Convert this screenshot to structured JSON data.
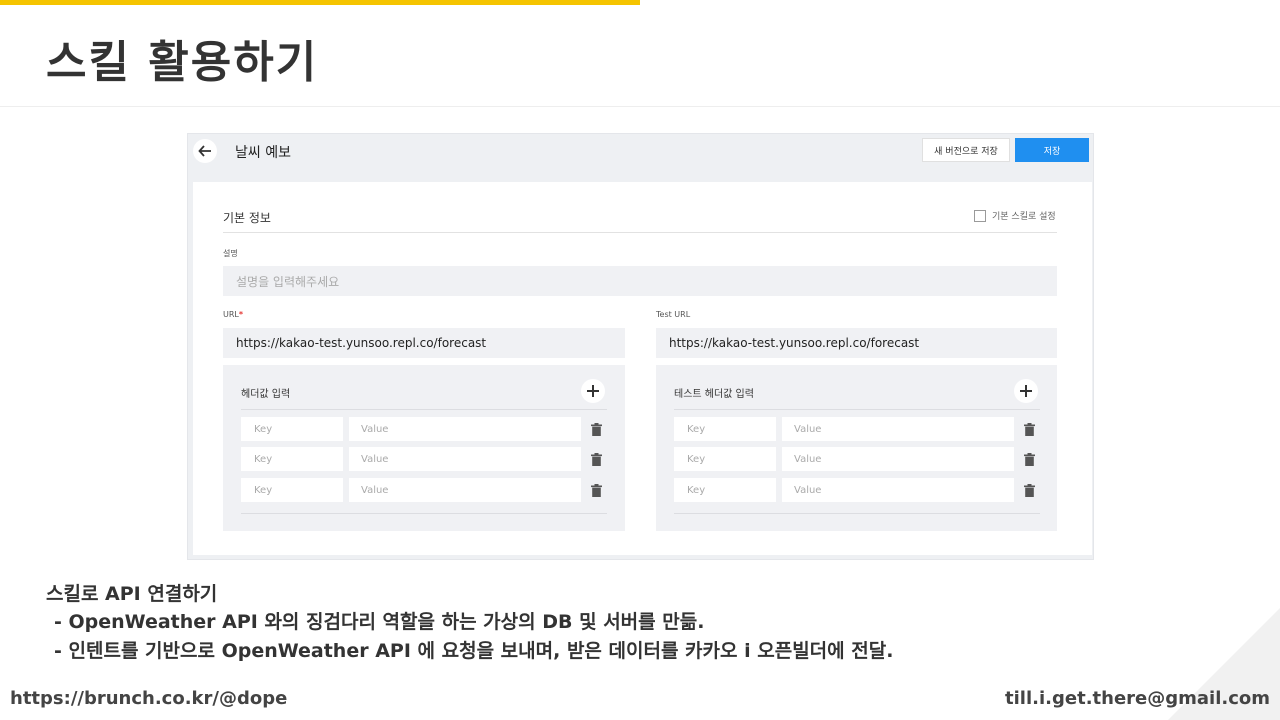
{
  "slide": {
    "title": "스킬 활용하기",
    "footer_left": "https://brunch.co.kr/@dope",
    "footer_right": "till.i.get.there@gmail.com"
  },
  "app": {
    "page_title": "날씨 예보",
    "save_new_label": "새 버전으로 저장",
    "save_label": "저장",
    "accent_color": "#1f8ff0"
  },
  "basic_info": {
    "section_title": "기본 정보",
    "default_skill_label": "기본 스킬로 설정",
    "description_label": "설명",
    "description_placeholder": "설명을 입력해주세요",
    "url_label": "URL",
    "url_required_mark": "*",
    "url_value": "https://kakao-test.yunsoo.repl.co/forecast",
    "test_url_label": "Test URL",
    "test_url_value": "https://kakao-test.yunsoo.repl.co/forecast"
  },
  "headers": {
    "title": "헤더값 입력",
    "rows": [
      {
        "key_placeholder": "Key",
        "value_placeholder": "Value"
      },
      {
        "key_placeholder": "Key",
        "value_placeholder": "Value"
      },
      {
        "key_placeholder": "Key",
        "value_placeholder": "Value"
      }
    ]
  },
  "test_headers": {
    "title": "테스트 헤더값 입력",
    "rows": [
      {
        "key_placeholder": "Key",
        "value_placeholder": "Value"
      },
      {
        "key_placeholder": "Key",
        "value_placeholder": "Value"
      },
      {
        "key_placeholder": "Key",
        "value_placeholder": "Value"
      }
    ]
  },
  "icons": {
    "back": "arrow-left-icon",
    "add": "plus-icon",
    "delete": "trash-icon"
  },
  "notes": {
    "heading": "스킬로 API 연결하기",
    "lines": [
      "- OpenWeather API 와의 징검다리 역할을 하는 가상의 DB 및 서버를 만듦.",
      "- 인텐트를 기반으로 OpenWeather API 에 요청을 보내며, 받은 데이터를 카카오 i 오픈빌더에 전달."
    ]
  }
}
